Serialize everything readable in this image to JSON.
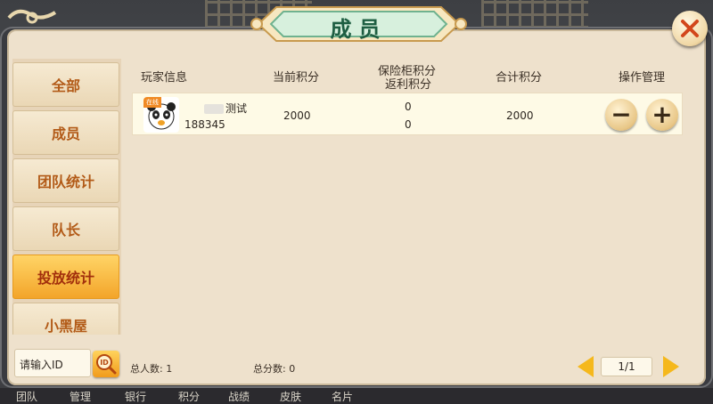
{
  "window": {
    "title": "成员"
  },
  "sidebar": {
    "tabs": [
      {
        "label": "全部",
        "active": false
      },
      {
        "label": "成员",
        "active": false
      },
      {
        "label": "团队统计",
        "active": false
      },
      {
        "label": "队长",
        "active": false
      },
      {
        "label": "投放统计",
        "active": true
      },
      {
        "label": "小黑屋",
        "active": false
      }
    ]
  },
  "table": {
    "headers": {
      "player_info": "玩家信息",
      "current_points": "当前积分",
      "safe_points_line1": "保险柜积分",
      "safe_points_line2": "返利积分",
      "total_points": "合计积分",
      "actions": "操作管理"
    },
    "rows": [
      {
        "badge": "在线",
        "name": "测试",
        "id": "188345",
        "current_points": "2000",
        "safe_points": "0",
        "rebate_points": "0",
        "total_points": "2000",
        "minus_label": "−",
        "plus_label": "+"
      }
    ]
  },
  "footer": {
    "search_placeholder": "请输入ID",
    "search_icon_label": "ID",
    "total_people": "总人数: 1",
    "total_points": "总分数: 0",
    "page": "1/1"
  },
  "bottom_bar": {
    "items": [
      "团队",
      "管理",
      "银行",
      "积分",
      "战绩",
      "皮肤",
      "名片"
    ]
  },
  "colors": {
    "accent_orange": "#f3a52a",
    "title_green": "#1e5e42",
    "tab_text": "#b25a17",
    "panel_bg": "#eee1cc"
  },
  "icons": {
    "close": "close-icon",
    "minus": "minus-icon",
    "plus": "plus-icon",
    "search_id": "id-search-icon",
    "prev": "prev-page-icon",
    "next": "next-page-icon",
    "avatar": "panda-avatar-icon"
  }
}
